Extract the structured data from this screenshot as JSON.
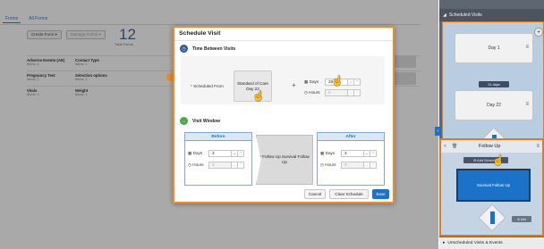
{
  "background": {
    "tabs": [
      "Forms",
      "All Forms"
    ],
    "create_form_label": "Create Form ▾",
    "manage_forms_label": "Manage Forms ▾",
    "total_forms_count": "12",
    "total_forms_caption": "Total Forms",
    "forms": [
      {
        "name": "Adverse Events (AE)",
        "items": "Items: 4"
      },
      {
        "name": "Contact Type",
        "items": "Items: 1"
      },
      {
        "name": "Pregnancy Test",
        "items": "Items: 2"
      },
      {
        "name": "Selection options",
        "items": "Items: 1"
      },
      {
        "name": "Vitals",
        "items": "Items: 1"
      },
      {
        "name": "Weight",
        "items": "Items: 1"
      }
    ]
  },
  "right_panel": {
    "scheduled_header": "Scheduled Visits",
    "day1_label": "Day 1",
    "days_pill": "21 days",
    "day22_label": "Day 22",
    "small_pill": "21 days",
    "follow_up_title": "Follow Up",
    "add_schedule_label": "⊕ Add Schedule",
    "survival_follow_up_label": "Survival Follow Up",
    "add_label": "⊕ Add",
    "unscheduled_label": "Unscheduled Visits & Events"
  },
  "modal": {
    "title": "Schedule Visit",
    "section1_title": "Time Between Visits",
    "scheduled_from_label": "Scheduled From",
    "reference_visit": "Standard of Care Day 22",
    "days_label": "Days",
    "days_value": "28",
    "hours_label": "Hours",
    "hours_value": "0",
    "section2_title": "Visit Window",
    "before": {
      "title": "Before",
      "days_label": "Days",
      "days_value": "3",
      "hours_label": "Hours",
      "hours_value": "0"
    },
    "center_visit": "Follow Up Survival Follow Up",
    "after": {
      "title": "After",
      "days_label": "Days",
      "days_value": "3",
      "hours_label": "Hours",
      "hours_value": "0"
    },
    "cancel_label": "Cancel",
    "clear_label": "Clear Schedule",
    "save_label": "Save"
  }
}
